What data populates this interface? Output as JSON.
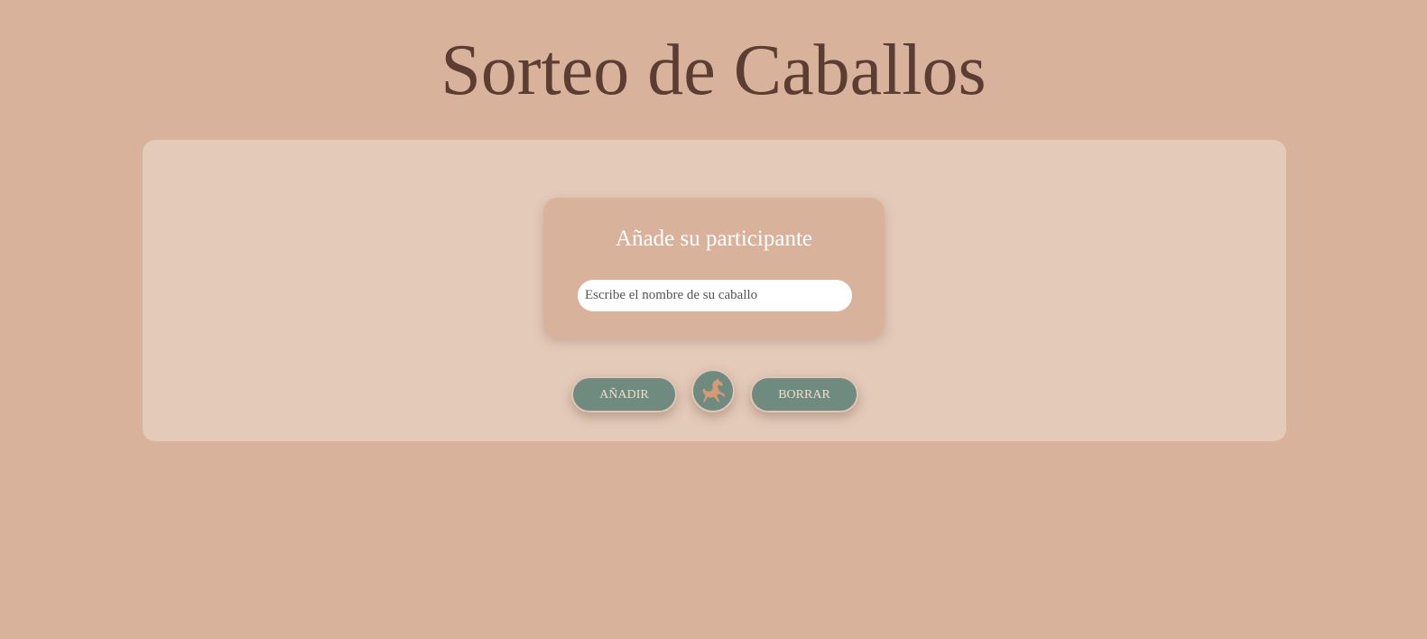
{
  "header": {
    "title": "Sorteo de Caballos"
  },
  "form": {
    "heading": "Añade su participante",
    "name_input": {
      "placeholder": "Escribe el nombre de su caballo",
      "value": ""
    }
  },
  "actions": {
    "add_label": "AÑADIR",
    "draw_icon": "horse-icon",
    "clear_label": "BORRAR"
  },
  "colors": {
    "background": "#d9b29b",
    "panel": "#e4cab9",
    "title": "#5c3d33",
    "button": "#6f8b80",
    "button_text": "#f1ddc9",
    "horse": "#d49a73"
  }
}
